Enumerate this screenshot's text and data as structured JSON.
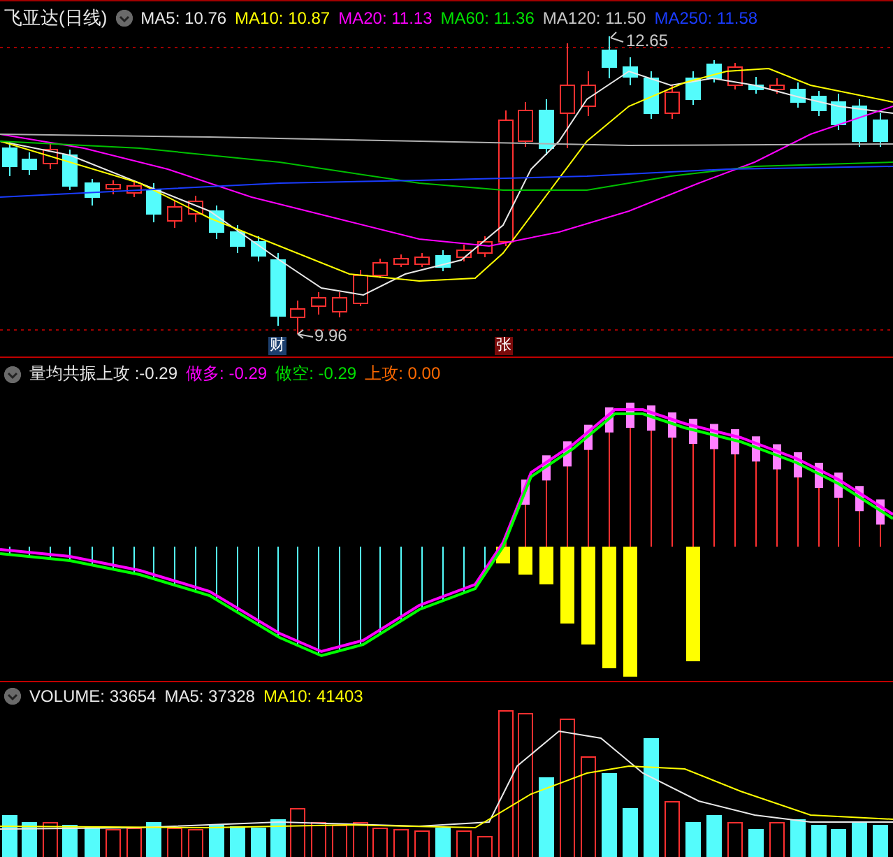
{
  "panels": [
    {
      "kind": "price",
      "title": "飞亚达(日线)",
      "indicators": [
        {
          "label": "MA5: 10.76",
          "color": "#e8e8e8"
        },
        {
          "label": "MA10: 10.87",
          "color": "#ffff00"
        },
        {
          "label": "MA20: 11.13",
          "color": "#ff00ff"
        },
        {
          "label": "MA60: 11.36",
          "color": "#00e000"
        },
        {
          "label": "MA120: 11.50",
          "color": "#c8c8c8"
        },
        {
          "label": "MA250: 11.58",
          "color": "#1a3cff"
        }
      ],
      "high_label": "12.65",
      "low_label": "9.96",
      "markers": [
        {
          "text": "财",
          "color": "#1c3f6e"
        },
        {
          "text": "张",
          "color": "#7a0a0a"
        }
      ]
    },
    {
      "kind": "oscillator",
      "indicators": [
        {
          "label": "量均共振上攻 :-0.29",
          "color": "#e8e8e8"
        },
        {
          "label": "做多: -0.29",
          "color": "#ff00ff"
        },
        {
          "label": "做空: -0.29",
          "color": "#00e000"
        },
        {
          "label": "上攻: 0.00",
          "color": "#ff6a00"
        }
      ]
    },
    {
      "kind": "volume",
      "indicators": [
        {
          "label": "VOLUME: 33654",
          "color": "#e8e8e8"
        },
        {
          "label": "MA5: 37328",
          "color": "#e8e8e8"
        },
        {
          "label": "MA10: 41403",
          "color": "#ffff00"
        }
      ]
    }
  ]
}
